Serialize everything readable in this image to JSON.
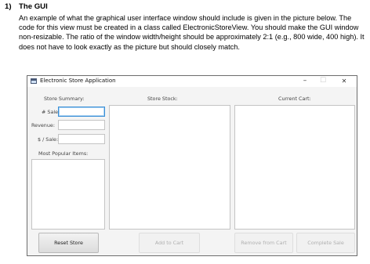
{
  "doc": {
    "number": "1)",
    "heading": "The GUI",
    "paragraph": "An example of what the graphical user interface window should include is given in the picture below. The code for this view must be created in a class called ElectronicStoreView. You should make the GUI window non-resizable. The ratio of the window width/height should be approximately 2:1 (e.g., 800 wide, 400 high). It does not have to look exactly as the picture but should closely match."
  },
  "window": {
    "title": "Electronic Store Application",
    "controls": {
      "minimize": "–",
      "maximize": "☐",
      "close": "✕"
    }
  },
  "summary": {
    "title": "Store Summary:",
    "sales_label": "# Sales:",
    "revenue_label": "Revenue:",
    "per_sale_label": "$ / Sale:",
    "popular_label": "Most Popular Items:"
  },
  "stock": {
    "title": "Store Stock:"
  },
  "cart": {
    "title": "Current Cart:"
  },
  "buttons": {
    "reset": "Reset Store",
    "add": "Add to Cart",
    "remove": "Remove from Cart",
    "complete": "Complete Sale"
  }
}
